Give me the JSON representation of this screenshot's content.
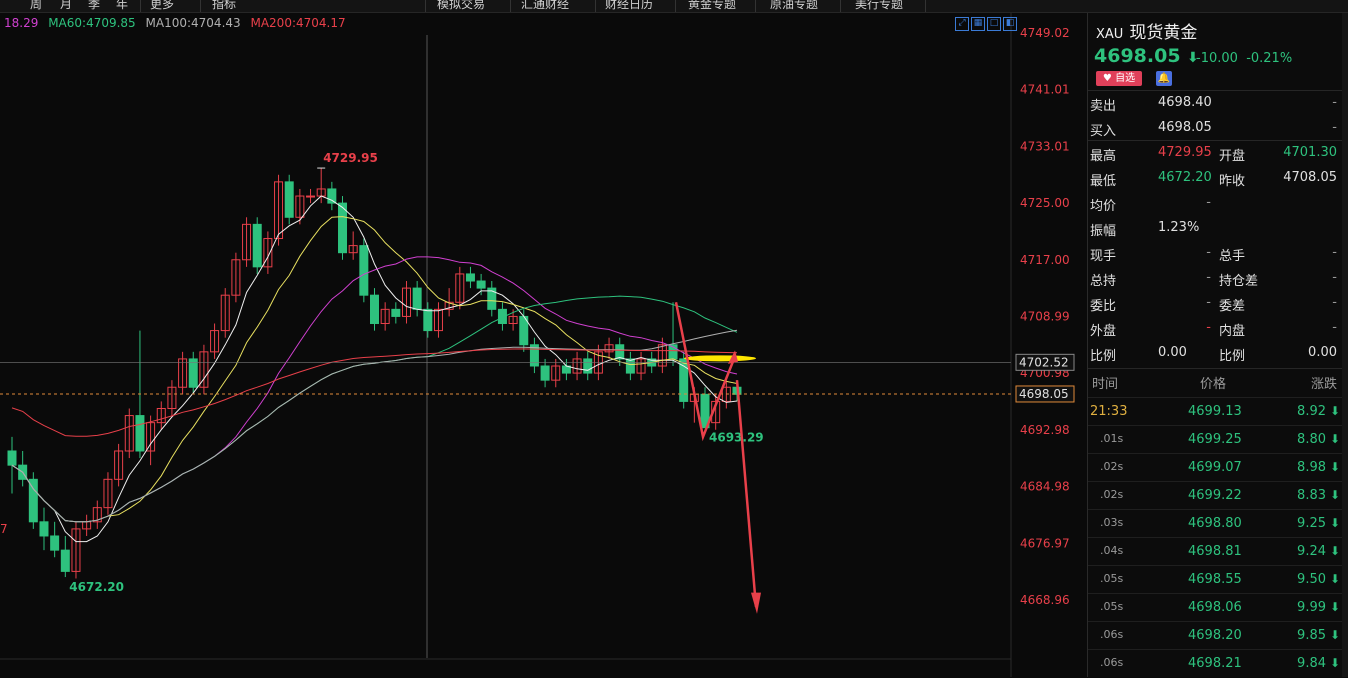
{
  "toolbar": {
    "items": [
      "周",
      "月",
      "季",
      "年",
      "更多",
      "指标",
      "模拟交易",
      "汇通财经",
      "财经日历",
      "黄金专题",
      "原油专题",
      "美行专题"
    ]
  },
  "ma_legend": {
    "ma_first": "18.29",
    "ma60": "MA60:4709.85",
    "ma100": "MA100:4704.43",
    "ma200": "MA200:4704.17",
    "colors": {
      "ma_first": "#d040d0",
      "ma60": "#2ec27e",
      "ma100": "#b0b0b0",
      "ma200": "#e8404a"
    }
  },
  "chart_data": {
    "type": "candlestick",
    "y_ticks": [
      "4749.02",
      "4741.01",
      "4733.01",
      "4725.00",
      "4717.00",
      "4708.99",
      "4700.98",
      "4692.98",
      "4684.98",
      "4676.97",
      "4668.96"
    ],
    "ylim": [
      4665.0,
      4752.0
    ],
    "annotations": {
      "high": "4729.95",
      "low": "4672.20",
      "recent_low": "4693.29"
    },
    "price_tags": {
      "line": "4702.52",
      "current": "4698.05"
    },
    "left_edge_labels": [
      "7"
    ],
    "candles": [
      [
        4690,
        4688,
        4684,
        4692
      ],
      [
        4688,
        4686,
        4685,
        4690
      ],
      [
        4686,
        4680,
        4679,
        4687
      ],
      [
        4680,
        4678,
        4676,
        4682
      ],
      [
        4678,
        4676,
        4675,
        4680
      ],
      [
        4676,
        4673,
        4672.2,
        4678
      ],
      [
        4673,
        4679,
        4672,
        4680
      ],
      [
        4679,
        4680,
        4678,
        4681
      ],
      [
        4680,
        4682,
        4679,
        4683
      ],
      [
        4682,
        4686,
        4681,
        4687
      ],
      [
        4686,
        4690,
        4685,
        4691
      ],
      [
        4690,
        4695,
        4689,
        4696
      ],
      [
        4695,
        4690,
        4689,
        4707
      ],
      [
        4690,
        4694,
        4688,
        4695
      ],
      [
        4694,
        4696,
        4693,
        4697
      ],
      [
        4696,
        4699,
        4695,
        4700
      ],
      [
        4699,
        4703,
        4698,
        4704
      ],
      [
        4703,
        4699,
        4698,
        4704
      ],
      [
        4699,
        4704,
        4698,
        4705
      ],
      [
        4704,
        4707,
        4703,
        4708
      ],
      [
        4707,
        4712,
        4706,
        4713
      ],
      [
        4712,
        4717,
        4711,
        4718
      ],
      [
        4717,
        4722,
        4716,
        4723
      ],
      [
        4722,
        4716,
        4715,
        4723
      ],
      [
        4716,
        4720,
        4715,
        4721
      ],
      [
        4720,
        4728,
        4719,
        4729
      ],
      [
        4728,
        4723,
        4722,
        4729
      ],
      [
        4723,
        4726,
        4722,
        4727
      ],
      [
        4726,
        4726,
        4725,
        4727
      ],
      [
        4726,
        4727,
        4725,
        4729.95
      ],
      [
        4727,
        4725,
        4724,
        4728
      ],
      [
        4725,
        4718,
        4717,
        4726
      ],
      [
        4718,
        4719,
        4717,
        4721
      ],
      [
        4719,
        4712,
        4711,
        4720
      ],
      [
        4712,
        4708,
        4707,
        4713
      ],
      [
        4708,
        4710,
        4707,
        4711
      ],
      [
        4710,
        4709,
        4708,
        4711
      ],
      [
        4709,
        4713,
        4708,
        4714
      ],
      [
        4713,
        4710,
        4709,
        4714
      ],
      [
        4710,
        4707,
        4706,
        4711
      ],
      [
        4707,
        4710,
        4706,
        4711
      ],
      [
        4710,
        4711,
        4709,
        4713
      ],
      [
        4711,
        4715,
        4710,
        4716
      ],
      [
        4715,
        4714,
        4713,
        4716
      ],
      [
        4714,
        4713,
        4712,
        4715
      ],
      [
        4713,
        4710,
        4709,
        4714
      ],
      [
        4710,
        4708,
        4707,
        4711
      ],
      [
        4708,
        4709,
        4707,
        4710
      ],
      [
        4709,
        4705,
        4704,
        4710
      ],
      [
        4705,
        4702,
        4701,
        4706
      ],
      [
        4702,
        4700,
        4699,
        4703
      ],
      [
        4700,
        4702,
        4699,
        4703
      ],
      [
        4702,
        4701,
        4700,
        4703
      ],
      [
        4701,
        4703,
        4700,
        4704
      ],
      [
        4703,
        4701,
        4700,
        4704
      ],
      [
        4701,
        4704,
        4700,
        4705
      ],
      [
        4704,
        4705,
        4703,
        4706
      ],
      [
        4705,
        4703,
        4702,
        4706
      ],
      [
        4703,
        4701,
        4700,
        4704
      ],
      [
        4701,
        4703,
        4700,
        4704
      ],
      [
        4703,
        4702,
        4701,
        4704
      ],
      [
        4702,
        4705,
        4701,
        4706
      ],
      [
        4705,
        4703,
        4702,
        4711
      ],
      [
        4703,
        4697,
        4696,
        4704
      ],
      [
        4697,
        4698,
        4694,
        4699
      ],
      [
        4698,
        4693.29,
        4693.29,
        4699
      ],
      [
        4694,
        4697,
        4693,
        4698
      ],
      [
        4697,
        4699,
        4696,
        4700
      ],
      [
        4699,
        4698,
        4697,
        4700
      ]
    ]
  },
  "right_panel": {
    "symbol": "XAU",
    "name": "现货黄金",
    "price": "4698.05",
    "change": "-10.00",
    "change_pct": "-0.21%",
    "watch_label": "自选",
    "rows": [
      {
        "l1": "卖出",
        "v1": "4698.40",
        "c1": "wh",
        "l2": "",
        "v2": "-",
        "c2": "gr"
      },
      {
        "l1": "买入",
        "v1": "4698.05",
        "c1": "wh",
        "l2": "",
        "v2": "-",
        "c2": "gr"
      },
      {
        "l1": "最高",
        "v1": "4729.95",
        "c1": "up",
        "l2": "开盘",
        "v2": "4701.30",
        "c2": "down"
      },
      {
        "l1": "最低",
        "v1": "4672.20",
        "c1": "down",
        "l2": "昨收",
        "v2": "4708.05",
        "c2": "wh"
      },
      {
        "l1": "均价",
        "v1": "-",
        "c1": "gr",
        "l2": "",
        "v2": "",
        "c2": "gr"
      },
      {
        "l1": "振幅",
        "v1": "1.23%",
        "c1": "wh",
        "l2": "",
        "v2": "",
        "c2": "gr"
      },
      {
        "l1": "现手",
        "v1": "-",
        "c1": "gr",
        "l2": "总手",
        "v2": "-",
        "c2": "gr"
      },
      {
        "l1": "总持",
        "v1": "-",
        "c1": "gr",
        "l2": "持仓差",
        "v2": "-",
        "c2": "gr"
      },
      {
        "l1": "委比",
        "v1": "-",
        "c1": "gr",
        "l2": "委差",
        "v2": "-",
        "c2": "gr"
      },
      {
        "l1": "外盘",
        "v1": "-",
        "c1": "up",
        "l2": "内盘",
        "v2": "-",
        "c2": "gr"
      },
      {
        "l1": "比例",
        "v1": "0.00",
        "c1": "wh",
        "l2": "比例",
        "v2": "0.00",
        "c2": "wh"
      }
    ],
    "ticks_header": {
      "time": "时间",
      "price": "价格",
      "chg": "涨跌"
    },
    "ticks": [
      {
        "t": "21:33",
        "p": "4699.13",
        "c": "8.92"
      },
      {
        "t": ".01s",
        "p": "4699.25",
        "c": "8.80"
      },
      {
        "t": ".02s",
        "p": "4699.07",
        "c": "8.98"
      },
      {
        "t": ".02s",
        "p": "4699.22",
        "c": "8.83"
      },
      {
        "t": ".03s",
        "p": "4698.80",
        "c": "9.25"
      },
      {
        "t": ".04s",
        "p": "4698.81",
        "c": "9.24"
      },
      {
        "t": ".05s",
        "p": "4698.55",
        "c": "9.50"
      },
      {
        "t": ".05s",
        "p": "4698.06",
        "c": "9.99"
      },
      {
        "t": ".06s",
        "p": "4698.20",
        "c": "9.85"
      },
      {
        "t": ".06s",
        "p": "4698.21",
        "c": "9.84"
      }
    ],
    "colors": {
      "up": "#e8404a",
      "down": "#2ec27e"
    }
  }
}
